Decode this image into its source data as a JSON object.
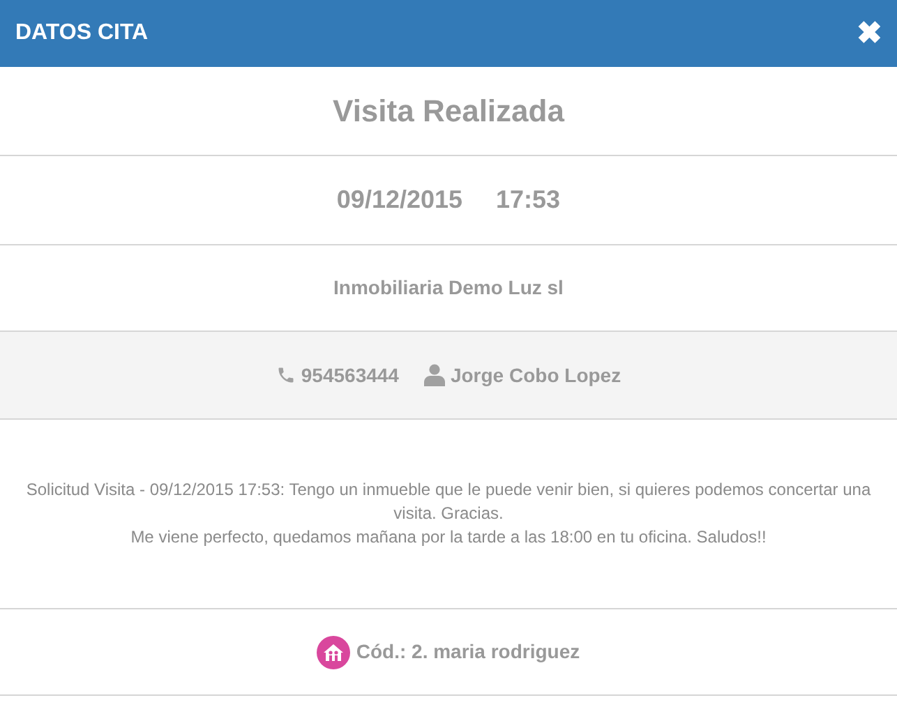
{
  "header": {
    "title": "DATOS CITA",
    "close": "✖"
  },
  "status": "Visita Realizada",
  "date": "09/12/2015",
  "time": "17:53",
  "agency": "Inmobiliaria Demo Luz sl",
  "contact": {
    "phone": "954563444",
    "name": "Jorge Cobo Lopez"
  },
  "messages": [
    "Solicitud Visita - 09/12/2015 17:53: Tengo un inmueble que le puede venir bien, si quieres podemos concertar una visita. Gracias.",
    "Me viene perfecto, quedamos mañana por la tarde a las 18:00 en tu oficina. Saludos!!"
  ],
  "code": "Cód.: 2. maria rodriguez"
}
